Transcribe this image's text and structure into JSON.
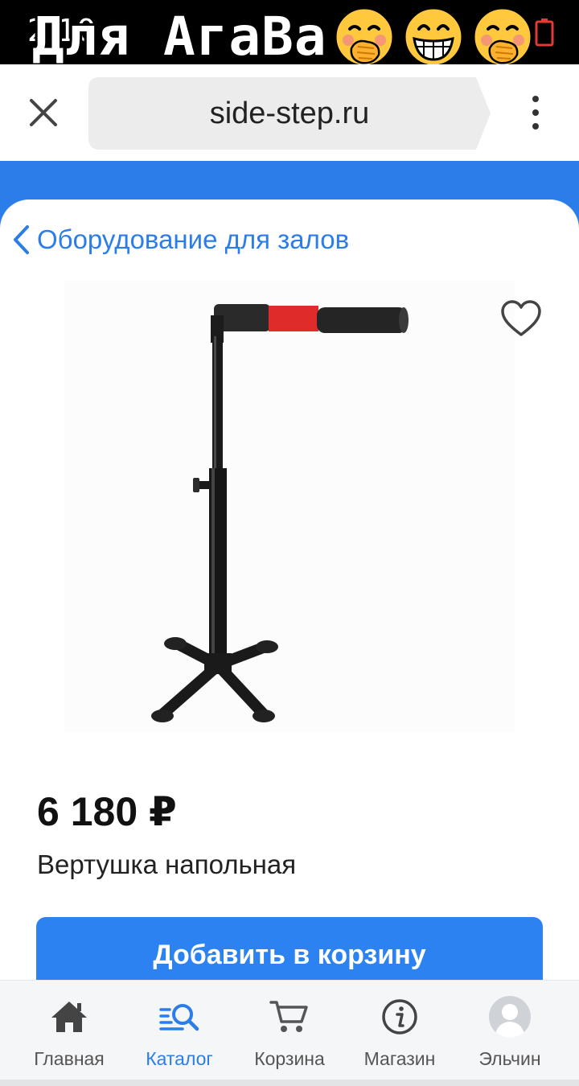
{
  "status_bar": {
    "time": "2:10",
    "overlay_caption": "Для АгаВа"
  },
  "browser": {
    "url": "side-step.ru"
  },
  "breadcrumb": {
    "back_label": "Оборудование для залов"
  },
  "product": {
    "price": "6 180 ₽",
    "name": "Вертушка напольная",
    "add_to_cart_label": "Добавить в корзину"
  },
  "bottom_nav": {
    "items": [
      {
        "label": "Главная",
        "icon": "home-icon"
      },
      {
        "label": "Каталог",
        "icon": "catalog-search-icon",
        "active": true
      },
      {
        "label": "Корзина",
        "icon": "cart-icon"
      },
      {
        "label": "Магазин",
        "icon": "info-icon"
      },
      {
        "label": "Эльчин",
        "icon": "avatar-icon"
      }
    ]
  },
  "colors": {
    "accent": "#2b7de9",
    "button": "#2b82f0",
    "nav_background": "#f5f6f8"
  }
}
